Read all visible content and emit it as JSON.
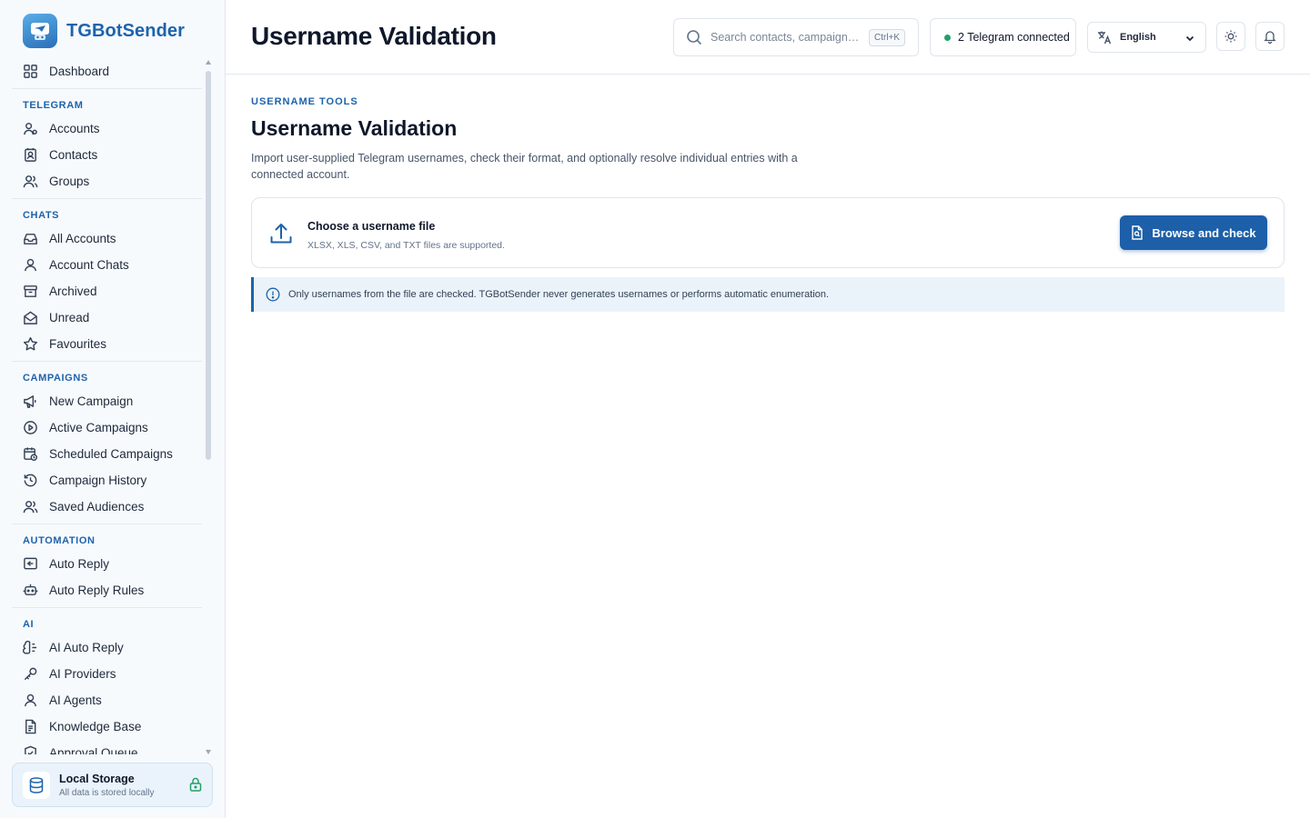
{
  "app": {
    "name": "TGBotSender"
  },
  "sidebar": {
    "top_item": {
      "label": "Dashboard",
      "icon": "dashboard-icon"
    },
    "sections": [
      {
        "title": "TELEGRAM",
        "items": [
          {
            "label": "Accounts",
            "icon": "accounts-icon"
          },
          {
            "label": "Contacts",
            "icon": "contacts-icon"
          },
          {
            "label": "Groups",
            "icon": "groups-icon"
          }
        ]
      },
      {
        "title": "CHATS",
        "items": [
          {
            "label": "All Accounts",
            "icon": "inbox-icon"
          },
          {
            "label": "Account Chats",
            "icon": "user-icon"
          },
          {
            "label": "Archived",
            "icon": "archive-icon"
          },
          {
            "label": "Unread",
            "icon": "envelope-open-icon"
          },
          {
            "label": "Favourites",
            "icon": "star-icon"
          }
        ]
      },
      {
        "title": "CAMPAIGNS",
        "items": [
          {
            "label": "New Campaign",
            "icon": "megaphone-icon"
          },
          {
            "label": "Active Campaigns",
            "icon": "play-circle-icon"
          },
          {
            "label": "Scheduled Campaigns",
            "icon": "calendar-clock-icon"
          },
          {
            "label": "Campaign History",
            "icon": "history-icon"
          },
          {
            "label": "Saved Audiences",
            "icon": "audience-icon"
          }
        ]
      },
      {
        "title": "AUTOMATION",
        "items": [
          {
            "label": "Auto Reply",
            "icon": "reply-icon"
          },
          {
            "label": "Auto Reply Rules",
            "icon": "bot-icon"
          }
        ]
      },
      {
        "title": "AI",
        "items": [
          {
            "label": "AI Auto Reply",
            "icon": "brain-icon"
          },
          {
            "label": "AI Providers",
            "icon": "key-icon"
          },
          {
            "label": "AI Agents",
            "icon": "agent-icon"
          },
          {
            "label": "Knowledge Base",
            "icon": "document-icon"
          },
          {
            "label": "Approval Queue",
            "icon": "shield-check-icon"
          }
        ]
      }
    ],
    "storage": {
      "title": "Local Storage",
      "subtitle": "All data is stored locally"
    }
  },
  "header": {
    "title": "Username Validation",
    "search": {
      "placeholder": "Search contacts, campaigns, t...",
      "shortcut": "Ctrl+K"
    },
    "connection_status": "2 Telegram connected",
    "language": "English"
  },
  "main": {
    "eyebrow": "USERNAME TOOLS",
    "title": "Username Validation",
    "description": "Import user-supplied Telegram usernames, check their format, and optionally resolve individual entries with a connected account.",
    "upload": {
      "title": "Choose a username file",
      "subtitle": "XLSX, XLS, CSV, and TXT files are supported.",
      "button_label": "Browse and check"
    },
    "notice": "Only usernames from the file are checked. TGBotSender never generates usernames or performs automatic enumeration."
  },
  "colors": {
    "accent": "#1d63ac",
    "button": "#1d5fa8",
    "status_online": "#22a06b",
    "notice_bg": "#eaf3fa"
  }
}
